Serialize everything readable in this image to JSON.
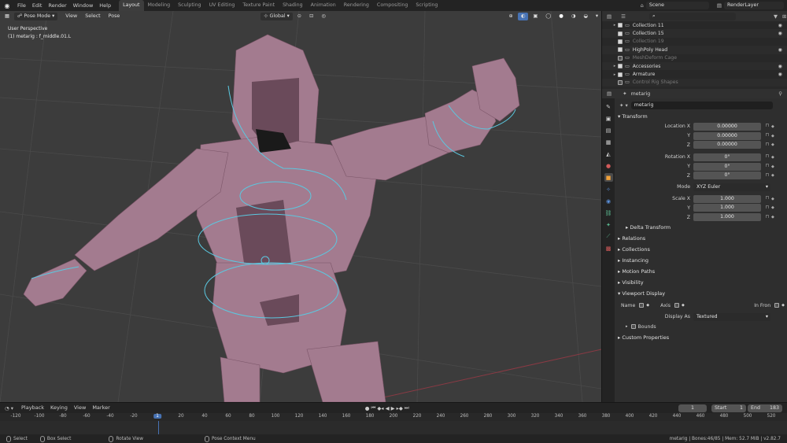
{
  "topbar": {
    "menus": [
      "File",
      "Edit",
      "Render",
      "Window",
      "Help"
    ],
    "workspaces": [
      "Layout",
      "Modeling",
      "Sculpting",
      "UV Editing",
      "Texture Paint",
      "Shading",
      "Animation",
      "Rendering",
      "Compositing",
      "Scripting"
    ],
    "active_workspace": "Layout",
    "scene": "Scene",
    "view_layer": "RenderLayer"
  },
  "viewport": {
    "mode": "Pose Mode",
    "menus": [
      "View",
      "Select",
      "Pose"
    ],
    "orientation": "Global",
    "perspective_label": "User Perspective",
    "active_label": "(1) metarig : f_middle.01.L"
  },
  "outliner": {
    "search_placeholder": "",
    "rows": [
      {
        "name": "Collection 11",
        "checked": true,
        "dim": false,
        "visible": true,
        "expand": "▸"
      },
      {
        "name": "Collection 15",
        "checked": true,
        "dim": false,
        "visible": true,
        "expand": ""
      },
      {
        "name": "Collection 19",
        "checked": true,
        "dim": true,
        "visible": false,
        "expand": ""
      },
      {
        "name": "HighPoly Head",
        "checked": true,
        "dim": false,
        "visible": true,
        "expand": ""
      },
      {
        "name": "MeshDeform Cage",
        "checked": false,
        "dim": true,
        "visible": false,
        "expand": ""
      },
      {
        "name": "Accessories",
        "checked": true,
        "dim": false,
        "visible": true,
        "expand": "▸"
      },
      {
        "name": "Armature",
        "checked": true,
        "dim": false,
        "visible": true,
        "expand": "▸"
      },
      {
        "name": "Control Rig Shapes",
        "checked": false,
        "dim": true,
        "visible": false,
        "expand": ""
      }
    ]
  },
  "properties": {
    "breadcrumb": "metarig",
    "object_name": "metarig",
    "transform": {
      "title": "Transform",
      "location_label": "Location X",
      "location": [
        "0.00000",
        "0.00000",
        "0.00000"
      ],
      "rotation_label": "Rotation X",
      "rotation": [
        "0°",
        "0°",
        "0°"
      ],
      "mode_label": "Mode",
      "mode": "XYZ Euler",
      "scale_label": "Scale X",
      "scale": [
        "1.000",
        "1.000",
        "1.000"
      ],
      "axis_y": "Y",
      "axis_z": "Z"
    },
    "delta_transform": "Delta Transform",
    "panels": [
      "Relations",
      "Collections",
      "Instancing",
      "Motion Paths",
      "Visibility"
    ],
    "viewport_display": {
      "title": "Viewport Display",
      "name_label": "Name",
      "axis_label": "Axis",
      "in_front_label": "In Fron",
      "display_as_label": "Display As",
      "display_as": "Textured",
      "bounds_label": "Bounds"
    },
    "custom_props": "Custom Properties"
  },
  "timeline": {
    "menus": [
      "Playback",
      "Keying",
      "View",
      "Marker"
    ],
    "current_frame": "1",
    "start_label": "Start",
    "start": "1",
    "end_label": "End",
    "end": "183",
    "ticks": [
      "-120",
      "-100",
      "-80",
      "-60",
      "-40",
      "-20",
      "1",
      "20",
      "40",
      "60",
      "80",
      "100",
      "120",
      "140",
      "160",
      "180",
      "200",
      "220",
      "240",
      "260",
      "280",
      "300",
      "320",
      "340",
      "360",
      "380",
      "400",
      "420",
      "440",
      "460",
      "480",
      "500",
      "520"
    ]
  },
  "statusbar": {
    "select": "Select",
    "box_select": "Box Select",
    "rotate_view": "Rotate View",
    "context_menu": "Pose Context Menu",
    "stats": "metarig | Bones:46/85 | Mem: 52.7 MiB | v2.82.7"
  },
  "colors": {
    "accent": "#4772b3",
    "viewport_bg": "#3c3c3c",
    "mesh": "#a37b8f",
    "bone_shape": "#5bc8e0"
  }
}
